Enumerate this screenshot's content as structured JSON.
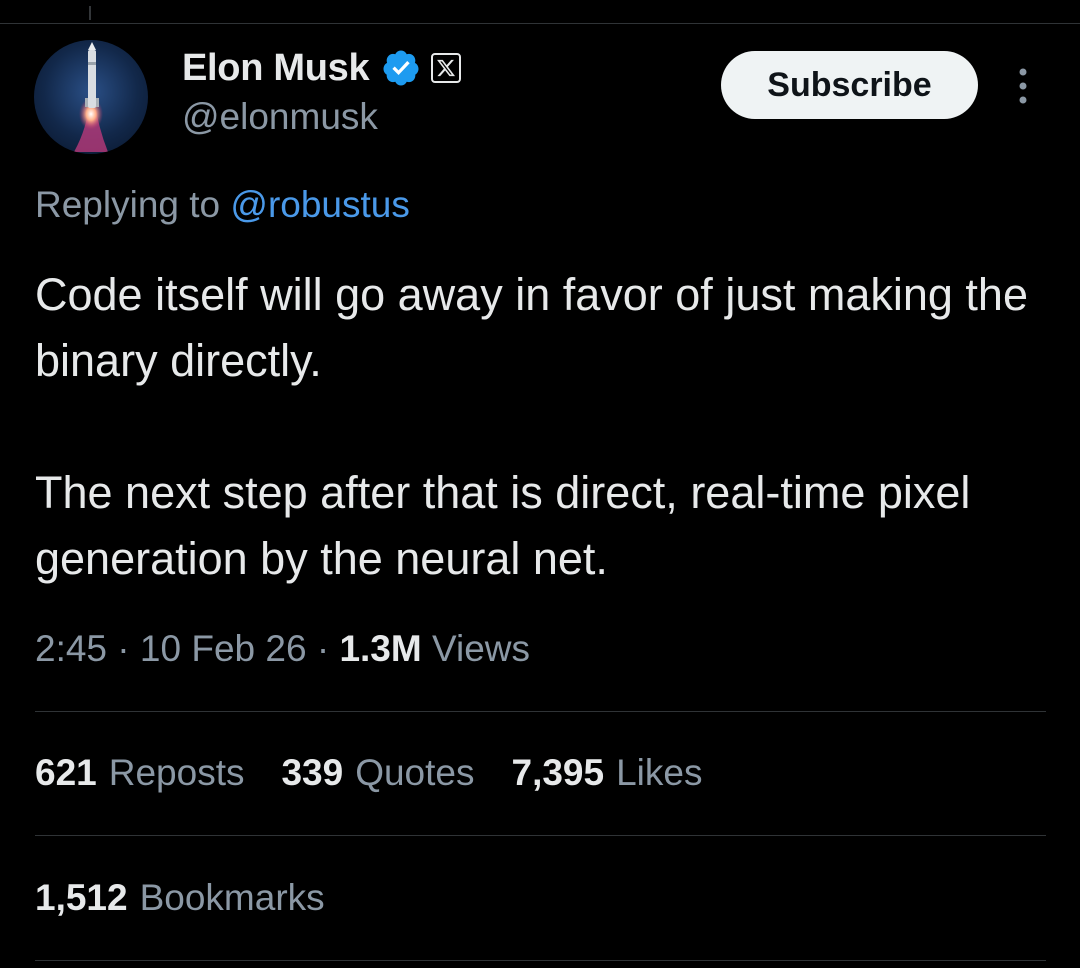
{
  "author": {
    "name": "Elon Musk",
    "handle": "@elonmusk",
    "avatar_icon": "rocket-launch-icon",
    "verified_color": "#1d9bf0"
  },
  "actions": {
    "subscribe_label": "Subscribe",
    "more_icon": "more-vertical-icon"
  },
  "reply": {
    "prefix": "Replying to",
    "to": "@robustus"
  },
  "tweet": {
    "paragraphs": [
      "Code itself will go away in favor of just making the binary directly.",
      "The next step after that is direct, real-time pixel generation by the neural net."
    ]
  },
  "meta": {
    "time": "2:45",
    "date": "10 Feb 26",
    "views_count": "1.3M",
    "views_label": "Views"
  },
  "stats": [
    {
      "count": "621",
      "label": "Reposts"
    },
    {
      "count": "339",
      "label": "Quotes"
    },
    {
      "count": "7,395",
      "label": "Likes"
    }
  ],
  "bookmarks": {
    "count": "1,512",
    "label": "Bookmarks"
  },
  "colors": {
    "background": "#000000",
    "text": "#e7e9ea",
    "secondary": "#8b98a5",
    "link": "#4a99e9",
    "divider": "#2f3336"
  }
}
